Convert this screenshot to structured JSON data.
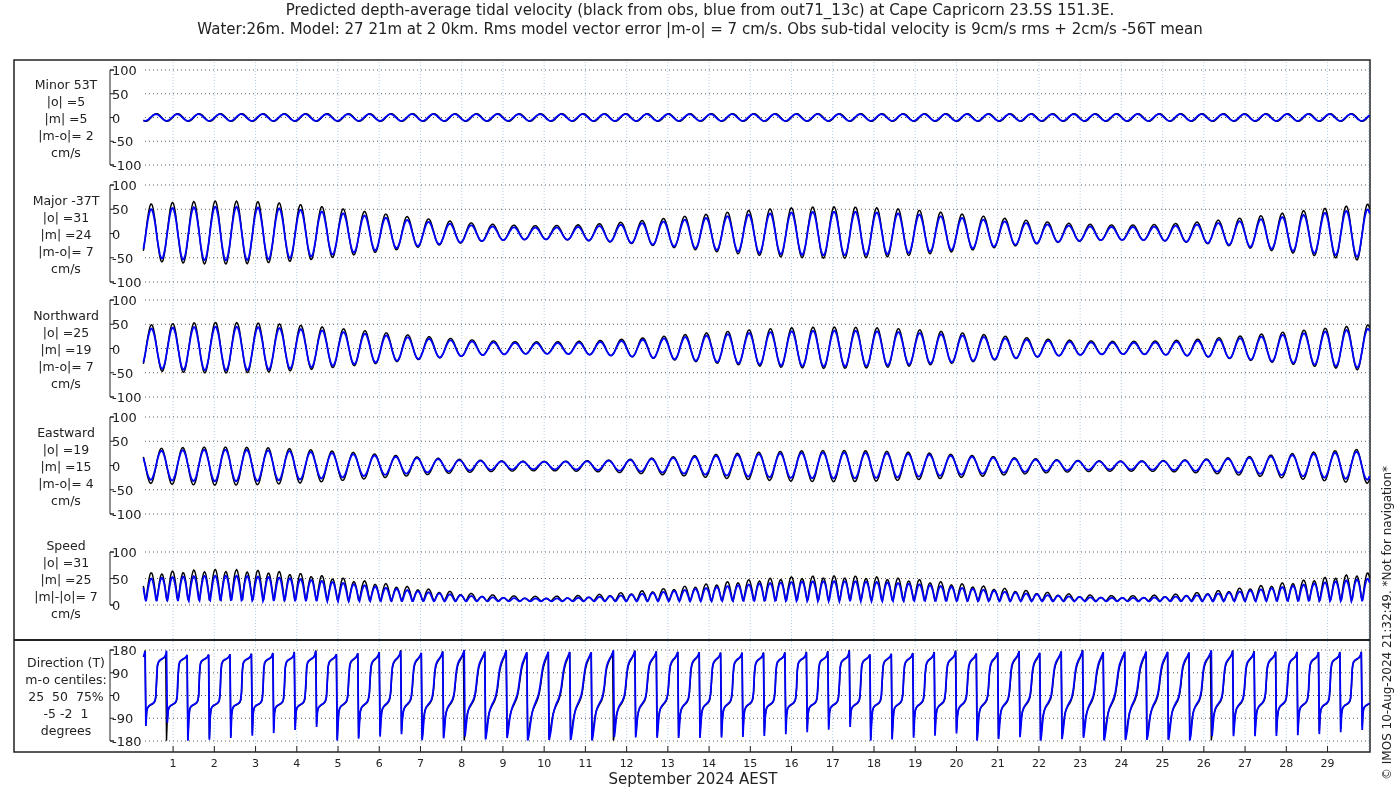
{
  "title": [
    "Predicted depth-average tidal velocity (black from obs, blue from out71_13c) at Cape Capricorn 23.5S 151.3E.",
    "Water:26m. Model: 27 21m at 2 0km. Rms model vector error |m-o| = 7 cm/s. Obs sub-tidal velocity is 9cm/s rms + 2cm/s -56T mean"
  ],
  "panels": [
    {
      "kind": "minor",
      "label": [
        "Minor 53T",
        "|o| =5",
        "|m| =5",
        "|m-o|= 2",
        "cm/s"
      ],
      "yticks": [
        "100",
        "50",
        "0",
        "-50",
        "-100"
      ]
    },
    {
      "kind": "major",
      "label": [
        "Major -37T",
        "|o| =31",
        "|m| =24",
        "|m-o|= 7",
        "cm/s"
      ],
      "yticks": [
        "100",
        "50",
        "0",
        "-50",
        "-100"
      ]
    },
    {
      "kind": "north",
      "label": [
        "Northward",
        "|o| =25",
        "|m| =19",
        "|m-o|= 7",
        "cm/s"
      ],
      "yticks": [
        "100",
        "50",
        "0",
        "-50",
        "-100"
      ]
    },
    {
      "kind": "east",
      "label": [
        "Eastward",
        "|o| =19",
        "|m| =15",
        "|m-o|= 4",
        "cm/s"
      ],
      "yticks": [
        "100",
        "50",
        "0",
        "-50",
        "-100"
      ]
    },
    {
      "kind": "speed",
      "label": [
        "Speed",
        "|o| =31",
        "|m| =25",
        "|m|-|o|= 7",
        "cm/s"
      ],
      "yticks": [
        "100",
        "50",
        "0"
      ]
    },
    {
      "kind": "direction",
      "label": [
        "Direction (T)",
        "m-o centiles:",
        "25  50  75%",
        "-5 -2  1",
        "degrees"
      ],
      "yticks": [
        "180",
        "90",
        "0",
        "-90",
        "-180"
      ]
    }
  ],
  "xticks": [
    "1",
    "2",
    "3",
    "4",
    "5",
    "6",
    "7",
    "8",
    "9",
    "10",
    "11",
    "12",
    "13",
    "14",
    "15",
    "16",
    "17",
    "18",
    "19",
    "20",
    "21",
    "22",
    "23",
    "24",
    "25",
    "26",
    "27",
    "28",
    "29"
  ],
  "xlabel": "September 2024 AEST",
  "credit": "© IMOS 10-Aug-2024 21:32:49. *Not for navigation*"
}
